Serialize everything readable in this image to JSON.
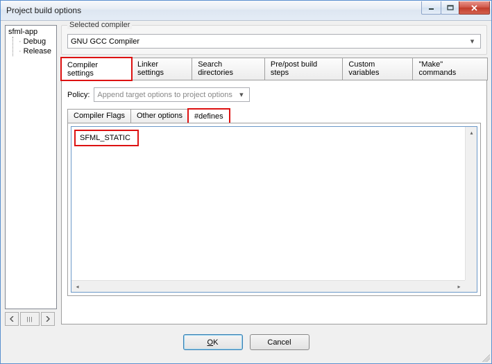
{
  "window": {
    "title": "Project build options"
  },
  "buttons": {
    "ok": "OK",
    "cancel": "Cancel"
  },
  "tree": {
    "root": "sfml-app",
    "children": [
      "Debug",
      "Release"
    ]
  },
  "selected_compiler": {
    "label": "Selected compiler",
    "value": "GNU GCC Compiler"
  },
  "tabs": {
    "items": [
      "Compiler settings",
      "Linker settings",
      "Search directories",
      "Pre/post build steps",
      "Custom variables",
      "\"Make\" commands"
    ],
    "active": 0
  },
  "policy": {
    "label": "Policy:",
    "value": "Append target options to project options"
  },
  "subtabs": {
    "items": [
      "Compiler Flags",
      "Other options",
      "#defines"
    ],
    "active": 2
  },
  "defines_text": "SFML_STATIC"
}
